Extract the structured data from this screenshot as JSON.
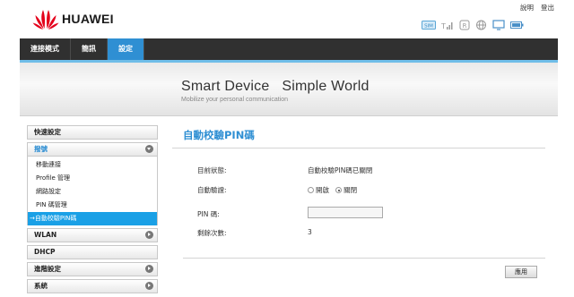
{
  "brand": {
    "name": "HUAWEI",
    "color": "#e4001b"
  },
  "top_links": {
    "help": "說明",
    "logout": "登出"
  },
  "status_icons": [
    "sim-icon",
    "signal-icon",
    "r-roaming-icon",
    "globe-icon",
    "monitor-icon",
    "battery-icon"
  ],
  "nav": {
    "items": [
      {
        "label": "連接模式",
        "active": false
      },
      {
        "label": "簡訊",
        "active": false
      },
      {
        "label": "設定",
        "active": true
      }
    ],
    "accent": "#2f8fd3"
  },
  "banner": {
    "title": "Smart Device   Simple World",
    "subtitle": "Mobilize your personal communication"
  },
  "sidebar": {
    "quick_setup": "快速設定",
    "dialup": "撥號",
    "dialup_items": [
      "移動連接",
      "Profile 管理",
      "網路設定",
      "PIN 碼管理",
      "→自動校驗PIN碼"
    ],
    "wlan": "WLAN",
    "dhcp": "DHCP",
    "advanced": "進階設定",
    "system": "系統"
  },
  "content": {
    "title": "自動校驗PIN碼",
    "status_label": "目前狀態:",
    "status_value": "自動校驗PIN碼已關閉",
    "auto_label": "自動驗證:",
    "option_on": "開啟",
    "option_off": "關閉",
    "selected": "關閉",
    "pin_label": "PIN 碼:",
    "pin_value": "",
    "remaining_label": "剩餘次數:",
    "remaining_value": "3",
    "apply": "應用"
  }
}
